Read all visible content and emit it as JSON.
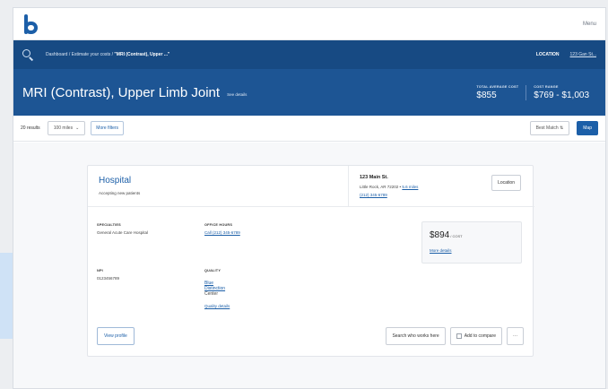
{
  "header": {
    "menu_label": "Menu"
  },
  "nav": {
    "breadcrumb_prefix": "Dashboard / Estimate your costs / ",
    "breadcrumb_current": "\"MRI (Contrast), Upper ...\"",
    "location_label": "LOCATION",
    "location_value": "123 Gan St..."
  },
  "hero": {
    "title": "MRI (Contrast), Upper Limb Joint",
    "details_link": "See details",
    "total_avg_label": "TOTAL AVERAGE COST",
    "total_avg_value": "$855",
    "cost_range_label": "COST RANGE",
    "cost_range_value": "$769 - $1,003"
  },
  "filters": {
    "results_count": "20 results",
    "distance": "100 miles",
    "more_filters": "More filters",
    "sort": "Best Match",
    "map_button": "Map"
  },
  "card": {
    "name": "Hospital",
    "accepting": "Accepting new patients",
    "street": "123 Main St.",
    "city": "Little Rock, AR 72202 • ",
    "distance_link": "5.6 miles",
    "phone": "(212) 345-6789",
    "location_button": "Location",
    "specialties_label": "SPECIALTIES",
    "specialties_value": "General Acute Care Hospital",
    "office_hours_label": "OFFICE HOURS",
    "office_hours_value": "Call (212) 345-6789",
    "npi_label": "NPI",
    "npi_value": "0123456789",
    "quality_label": "QUALITY",
    "quality_line1": "Blue",
    "quality_line2": "Distinction",
    "quality_line3": "Center",
    "quality_details": "Quality details",
    "price": "$894",
    "price_unit": "/ COST",
    "more_details": "More details",
    "view_profile": "View profile",
    "search_who_works": "Search who works here",
    "add_compare": "Add to compare",
    "more_actions": "···"
  }
}
